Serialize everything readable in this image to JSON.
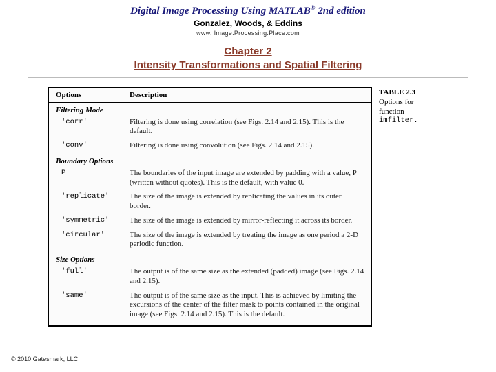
{
  "header": {
    "title_pre": "Digital Image Processing Using MATLAB",
    "title_sup": "®",
    "title_post": "  2nd edition",
    "authors": "Gonzalez, Woods, & Eddins",
    "site": "www. Image.Processing.Place.com"
  },
  "chapter": {
    "line1": "Chapter 2",
    "line2": "Intensity Transformations and Spatial Filtering"
  },
  "table": {
    "head_options": "Options",
    "head_description": "Description",
    "sections": {
      "filtering": "Filtering Mode",
      "boundary": "Boundary Options",
      "size": "Size Options"
    },
    "rows": {
      "corr": {
        "opt": "'corr'",
        "desc": "Filtering is done using correlation (see Figs. 2.14 and 2.15). This is the default."
      },
      "conv": {
        "opt": "'conv'",
        "desc": "Filtering is done using convolution (see Figs. 2.14 and 2.15)."
      },
      "p": {
        "opt": "P",
        "desc": "The boundaries of the input image are extended by padding with a value, P (written without quotes). This is the default, with value 0."
      },
      "replicate": {
        "opt": "'replicate'",
        "desc": "The size of the image is extended by replicating the values in its outer border."
      },
      "symmetric": {
        "opt": "'symmetric'",
        "desc": "The size of the image is extended by mirror-reflecting it across its border."
      },
      "circular": {
        "opt": "'circular'",
        "desc": "The size of the image is extended by treating the image as one period a 2-D periodic function."
      },
      "full": {
        "opt": "'full'",
        "desc": "The output is of the same size as the extended (padded) image (see Figs. 2.14 and 2.15)."
      },
      "same": {
        "opt": "'same'",
        "desc": "The output is of the same size as the input. This is achieved by limiting the excursions of the center of the filter mask to points contained in the original image (see Figs. 2.14 and 2.15). This is the default."
      }
    }
  },
  "side": {
    "tbl": "TABLE 2.3",
    "line1": "Options for",
    "line2": "function",
    "func": "imfilter."
  },
  "copyright": "© 2010 Gatesmark, LLC"
}
